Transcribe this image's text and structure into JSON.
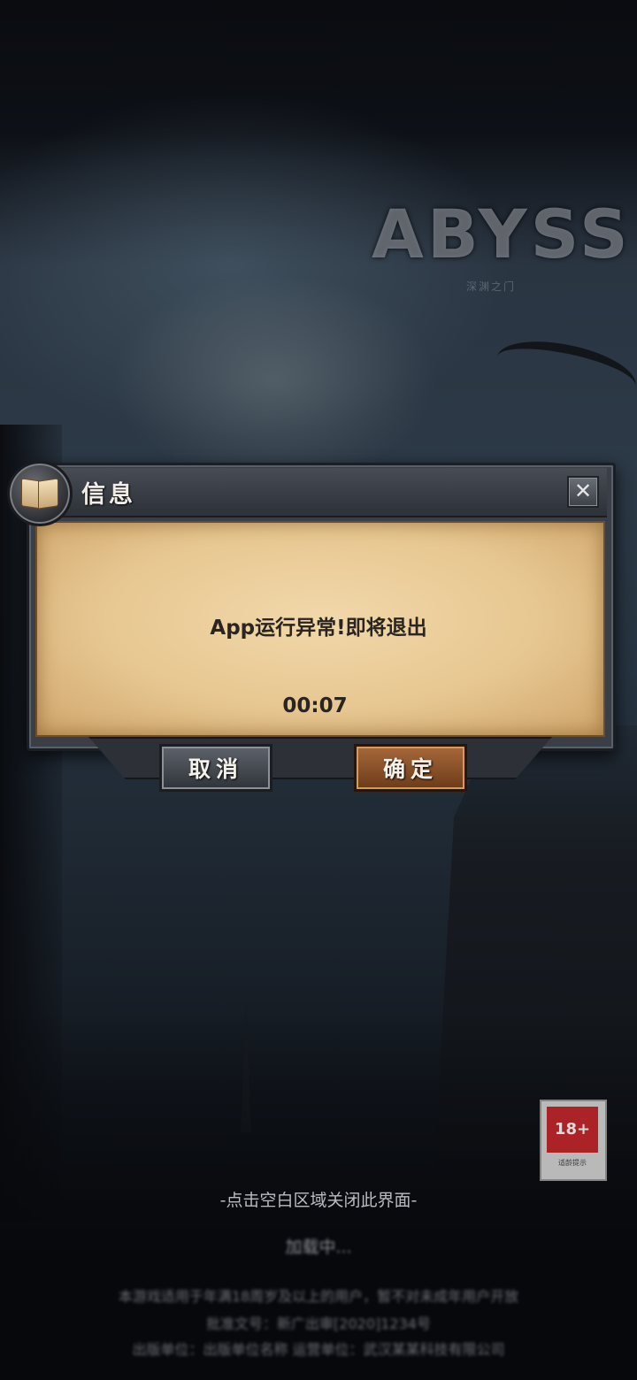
{
  "logo": {
    "text": "ABYSS",
    "subtitle": "深渊之门"
  },
  "dialog": {
    "title": "信息",
    "close_symbol": "✕",
    "message": "App运行异常!即将退出",
    "timer": "00:07",
    "cancel_label": "取消",
    "confirm_label": "确定"
  },
  "age_rating": {
    "label": "18+",
    "caption": "适龄提示"
  },
  "hint": "-点击空白区域关闭此界面-",
  "loading": "加载中...",
  "legal": {
    "line1": "本游戏适用于年满18周岁及以上的用户，暂不对未成年用户开放",
    "line2": "批准文号：新广出审[2020]1234号",
    "line3": "出版单位：出版单位名称    运营单位：武汉某某科技有限公司"
  },
  "colors": {
    "confirm_button": "#8a4f27",
    "cancel_button": "#474b52",
    "parchment": "#e7c791",
    "frame": "#3a3f47"
  },
  "icons": {
    "badge": "book-icon",
    "close": "close-icon"
  }
}
